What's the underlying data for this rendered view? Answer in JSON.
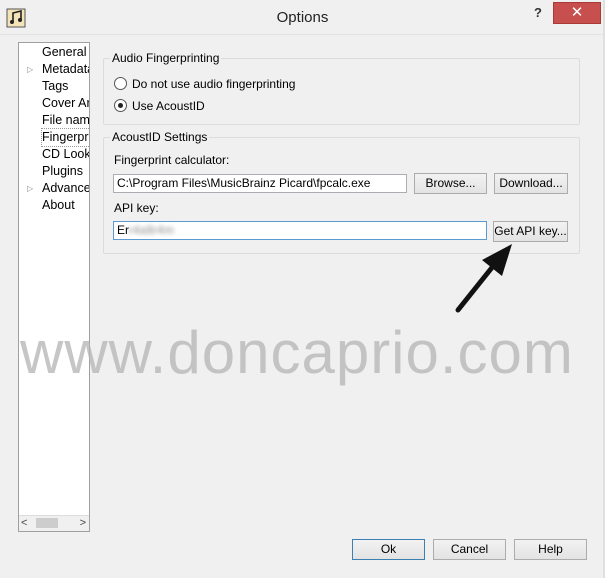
{
  "window": {
    "title": "Options",
    "help_label": "?",
    "close_label": "✕"
  },
  "nav": {
    "items": [
      {
        "label": "General",
        "expandable": false
      },
      {
        "label": "Metadata",
        "expandable": true
      },
      {
        "label": "Tags",
        "expandable": false
      },
      {
        "label": "Cover Art",
        "expandable": false
      },
      {
        "label": "File naming",
        "expandable": false
      },
      {
        "label": "Fingerprinting",
        "expandable": false,
        "selected": true
      },
      {
        "label": "CD Lookup",
        "expandable": false
      },
      {
        "label": "Plugins",
        "expandable": false
      },
      {
        "label": "Advanced",
        "expandable": true
      },
      {
        "label": "About",
        "expandable": false
      }
    ]
  },
  "audio_fp": {
    "title": "Audio Fingerprinting",
    "option_none": "Do not use audio fingerprinting",
    "option_acoustid": "Use AcoustID",
    "selected": "acoustid"
  },
  "acoustid": {
    "title": "AcoustID Settings",
    "calc_label": "Fingerprint calculator:",
    "calc_value": "C:\\Program Files\\MusicBrainz Picard\\fpcalc.exe",
    "browse_label": "Browse...",
    "download_label": "Download...",
    "api_label": "API key:",
    "api_value_visible": "Er",
    "api_value_blurred": "r4a8r4m",
    "get_key_label": "Get API key..."
  },
  "footer": {
    "ok": "Ok",
    "cancel": "Cancel",
    "help": "Help"
  },
  "watermark": "www.doncaprio.com",
  "colors": {
    "close": "#c7504f",
    "focus_border": "#5c9ad1",
    "default_border": "#3c7fb1"
  }
}
